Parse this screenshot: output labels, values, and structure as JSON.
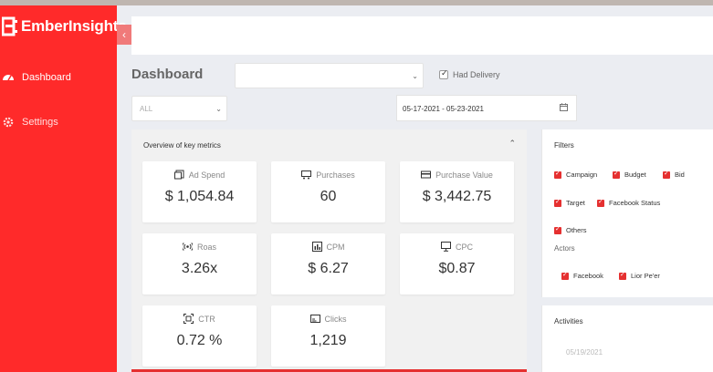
{
  "brand": {
    "name": "EmberInsights"
  },
  "sidebar": {
    "items": [
      {
        "label": "Dashboard",
        "icon": "dashboard-icon"
      },
      {
        "label": "Settings",
        "icon": "gear-icon"
      }
    ]
  },
  "main": {
    "title": "Dashboard",
    "campaign_select": {
      "value": ""
    },
    "had_delivery": {
      "label": "Had Delivery",
      "checked": true
    },
    "scope_select": {
      "value": "ALL"
    },
    "date_range": {
      "value": "05-17-2021 - 05-23-2021"
    }
  },
  "metrics": {
    "title": "Overview of key metrics",
    "cards": [
      {
        "label": "Ad Spend",
        "value": "$ 1,054.84",
        "icon": "ad-spend-icon"
      },
      {
        "label": "Purchases",
        "value": "60",
        "icon": "cart-icon"
      },
      {
        "label": "Purchase Value",
        "value": "$ 3,442.75",
        "icon": "credit-card-icon"
      },
      {
        "label": "Roas",
        "value": "3.26x",
        "icon": "broadcast-icon"
      },
      {
        "label": "CPM",
        "value": "$ 6.27",
        "icon": "bar-chart-icon"
      },
      {
        "label": "CPC",
        "value": "$0.87",
        "icon": "monitor-icon"
      },
      {
        "label": "CTR",
        "value": "0.72 %",
        "icon": "expand-icon"
      },
      {
        "label": "Clicks",
        "value": "1,219",
        "icon": "card-icon"
      }
    ]
  },
  "filters": {
    "title": "Filters",
    "options": [
      "Campaign",
      "Budget",
      "Bid",
      "Target",
      "Facebook Status",
      "Others"
    ],
    "actors_label": "Actors",
    "actors": [
      "Facebook",
      "Lior Pe'er"
    ]
  },
  "activities": {
    "title": "Activities",
    "date": "05/19/2021"
  },
  "colors": {
    "accent": "#ff2a2a",
    "checkbox": "#e53030",
    "background": "#ebedf2"
  }
}
